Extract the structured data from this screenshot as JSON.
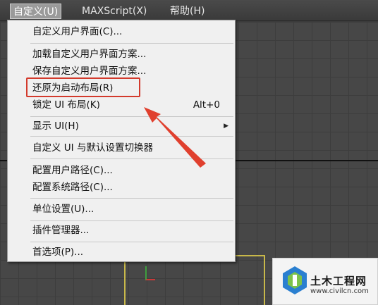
{
  "menubar": {
    "items": [
      {
        "label": "自定义(U)"
      },
      {
        "label": "MAXScript(X)"
      },
      {
        "label": "帮助(H)"
      }
    ]
  },
  "dropdown": {
    "items": [
      {
        "label": "自定义用户界面(C)..."
      },
      {
        "label": "加载自定义用户界面方案..."
      },
      {
        "label": "保存自定义用户界面方案..."
      },
      {
        "label": "还原为启动布局(R)"
      },
      {
        "label": "锁定 UI 布局(K)",
        "shortcut": "Alt+0"
      },
      {
        "label": "显示 UI(H)",
        "has_submenu": true
      },
      {
        "label": "自定义 UI 与默认设置切换器"
      },
      {
        "label": "配置用户路径(C)..."
      },
      {
        "label": "配置系统路径(C)..."
      },
      {
        "label": "单位设置(U)..."
      },
      {
        "label": "插件管理器..."
      },
      {
        "label": "首选项(P)..."
      }
    ]
  },
  "annotation": {
    "highlight_color": "#d33a2c",
    "arrow_color": "#e0402e"
  },
  "watermark": {
    "title": "土木工程网",
    "url": "www.civilcn.com"
  }
}
